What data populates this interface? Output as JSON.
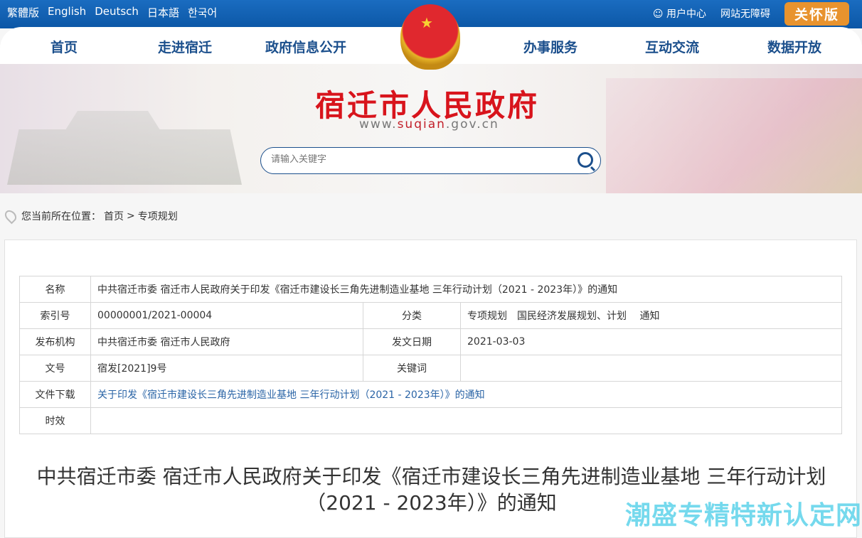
{
  "topbar": {
    "languages": [
      "繁體版",
      "English",
      "Deutsch",
      "日本語",
      "한국어"
    ],
    "user_center": "用户中心",
    "accessibility": "网站无障碍",
    "care_version": "关怀版"
  },
  "nav": {
    "items": [
      "首页",
      "走进宿迁",
      "政府信息公开",
      "办事服务",
      "互动交流",
      "数据开放"
    ]
  },
  "banner": {
    "title": "宿迁市人民政府",
    "url_prefix": "www.",
    "url_domain": "suqian",
    "url_suffix": ".gov.cn",
    "search_placeholder": "请输入关键字"
  },
  "breadcrumb": {
    "label": "您当前所在位置：",
    "items": [
      "首页",
      "专项规划"
    ],
    "separator": ">"
  },
  "info": {
    "name_label": "名称",
    "name": "中共宿迁市委 宿迁市人民政府关于印发《宿迁市建设长三角先进制造业基地 三年行动计划（2021 - 2023年）》的通知",
    "index_label": "索引号",
    "index": "00000001/2021-00004",
    "category_label": "分类",
    "category": "专项规划　国民经济发展规划、计划　 通知",
    "publisher_label": "发布机构",
    "publisher": "中共宿迁市委 宿迁市人民政府",
    "date_label": "发文日期",
    "date": "2021-03-03",
    "doc_no_label": "文号",
    "doc_no": "宿发[2021]9号",
    "keywords_label": "关键词",
    "keywords": "",
    "download_label": "文件下载",
    "download": "关于印发《宿迁市建设长三角先进制造业基地 三年行动计划（2021 - 2023年）》的通知",
    "validity_label": "时效",
    "validity": ""
  },
  "document": {
    "title": "中共宿迁市委 宿迁市人民政府关于印发《宿迁市建设长三角先进制造业基地 三年行动计划（2021 - 2023年）》的通知"
  },
  "watermark": "潮盛专精特新认定网",
  "colors": {
    "topbar": "#0c57a6",
    "nav_text": "#1b4f8c",
    "care": "#e8932e",
    "title_red": "#d8141c",
    "link": "#2a64a6"
  }
}
